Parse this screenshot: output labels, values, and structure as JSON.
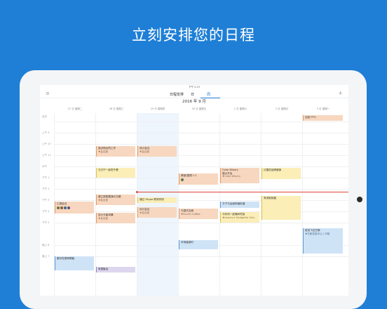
{
  "headline": "立刻安排您的日程",
  "status_time": "下午 2:15",
  "nav": {
    "menu_icon": "menu-icon",
    "add_icon": "plus-icon",
    "tabs": [
      {
        "label": "日程安排",
        "active": false
      },
      {
        "label": "日",
        "active": false
      },
      {
        "label": "周",
        "active": true
      }
    ]
  },
  "month_title": "2016 年 9 月",
  "days": [
    "27 日 星期二",
    "28 日 星期三",
    "29 日 星期四",
    "30 日 星期五",
    "1 日 星期六",
    "2 日 星期日",
    "3 日 星期一"
  ],
  "allday_label": "全天",
  "hours": [
    "上午 9",
    "上午 10",
    "上午 11",
    "中午",
    "下午 1",
    "下午 2",
    "下午 3",
    "下午 4",
    "下午 5",
    "晚上 6",
    "晚上 7"
  ],
  "events": {
    "pto": {
      "title": "加班 PTO"
    },
    "budget_review": {
      "title": "面试和合同工作",
      "sub": "♦会议室"
    },
    "design_review": {
      "title": "设计会议",
      "sub": "♦会议室"
    },
    "lunch_chat": {
      "title": "与万宁一起吃午餐"
    },
    "team_sync": {
      "title": "跨部/整理 1:1"
    },
    "coho_winery": {
      "title": "Coho Winery",
      "sub": "建大开会",
      "sub2": "♦Coho Winery"
    },
    "product_review": {
      "title": "仪整的品牌营销"
    },
    "standup": {
      "title": "汇报会议"
    },
    "plan_launch": {
      "title": "建立新数据演示文稿",
      "sub": "♦会议室"
    },
    "skype_call": {
      "title": "通过 Skype 联系陈栩"
    },
    "lecture": {
      "title": "有用就就塞"
    },
    "design_meeting": {
      "title": "设计头脑风暴",
      "sub": "♦会议室"
    },
    "design_review2": {
      "title": "设计会议",
      "sub": "♦会议室"
    },
    "coffee": {
      "title": "与莫氏见面",
      "sub": "♦Fourth Coffee"
    },
    "workshop": {
      "title": "万宁与后面和谐街道"
    },
    "dinner_plan": {
      "title": "与利利一起晚间吃饭",
      "sub": "♦Liberty's Delightful Sinf..."
    },
    "flight": {
      "title": "航班飞往巴黎",
      "sub": "♦天航发射中心 | 中航"
    },
    "marketing": {
      "title": "市场营销时"
    },
    "team_dinner": {
      "title": "跟乐性是两联聚"
    },
    "family_party": {
      "title": "家庭聚会"
    }
  },
  "colors": {
    "background": "#1f7fd6",
    "accent": "#1e78d0",
    "orange": "#f7d7bf",
    "yellow": "#fbeeb6",
    "blue": "#cfe3f6",
    "purple": "#dcd6ef",
    "now_line": "#e0453a"
  }
}
